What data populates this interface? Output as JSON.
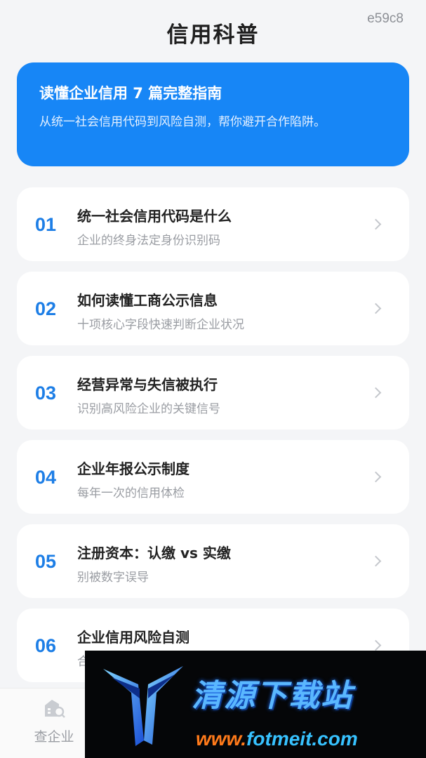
{
  "header": {
    "code": "e59c8",
    "title": "信用科普"
  },
  "banner": {
    "title": "读懂企业信用 7 篇完整指南",
    "subtitle": "从统一社会信用代码到风险自测，帮你避开合作陷阱。"
  },
  "articles": [
    {
      "num": "01",
      "title": "统一社会信用代码是什么",
      "subtitle": "企业的终身法定身份识别码"
    },
    {
      "num": "02",
      "title": "如何读懂工商公示信息",
      "subtitle": "十项核心字段快速判断企业状况"
    },
    {
      "num": "03",
      "title": "经营异常与失信被执行",
      "subtitle": "识别高风险企业的关键信号"
    },
    {
      "num": "04",
      "title": "企业年报公示制度",
      "subtitle": "每年一次的信用体检"
    },
    {
      "num": "05",
      "title": "注册资本：认缴 vs 实缴",
      "subtitle": "别被数字误导"
    },
    {
      "num": "06",
      "title": "企业信用风险自测",
      "subtitle": "合"
    }
  ],
  "tabbar": {
    "tab1_label": "查企业",
    "tab1_icon": "company-search-icon"
  },
  "watermark": {
    "name": "清源下载站",
    "url_prefix": "www.",
    "url_main": "fotmeit.com"
  },
  "colors": {
    "accent": "#1786f6",
    "number": "#1d7ee6",
    "background": "#f4f5f7"
  }
}
